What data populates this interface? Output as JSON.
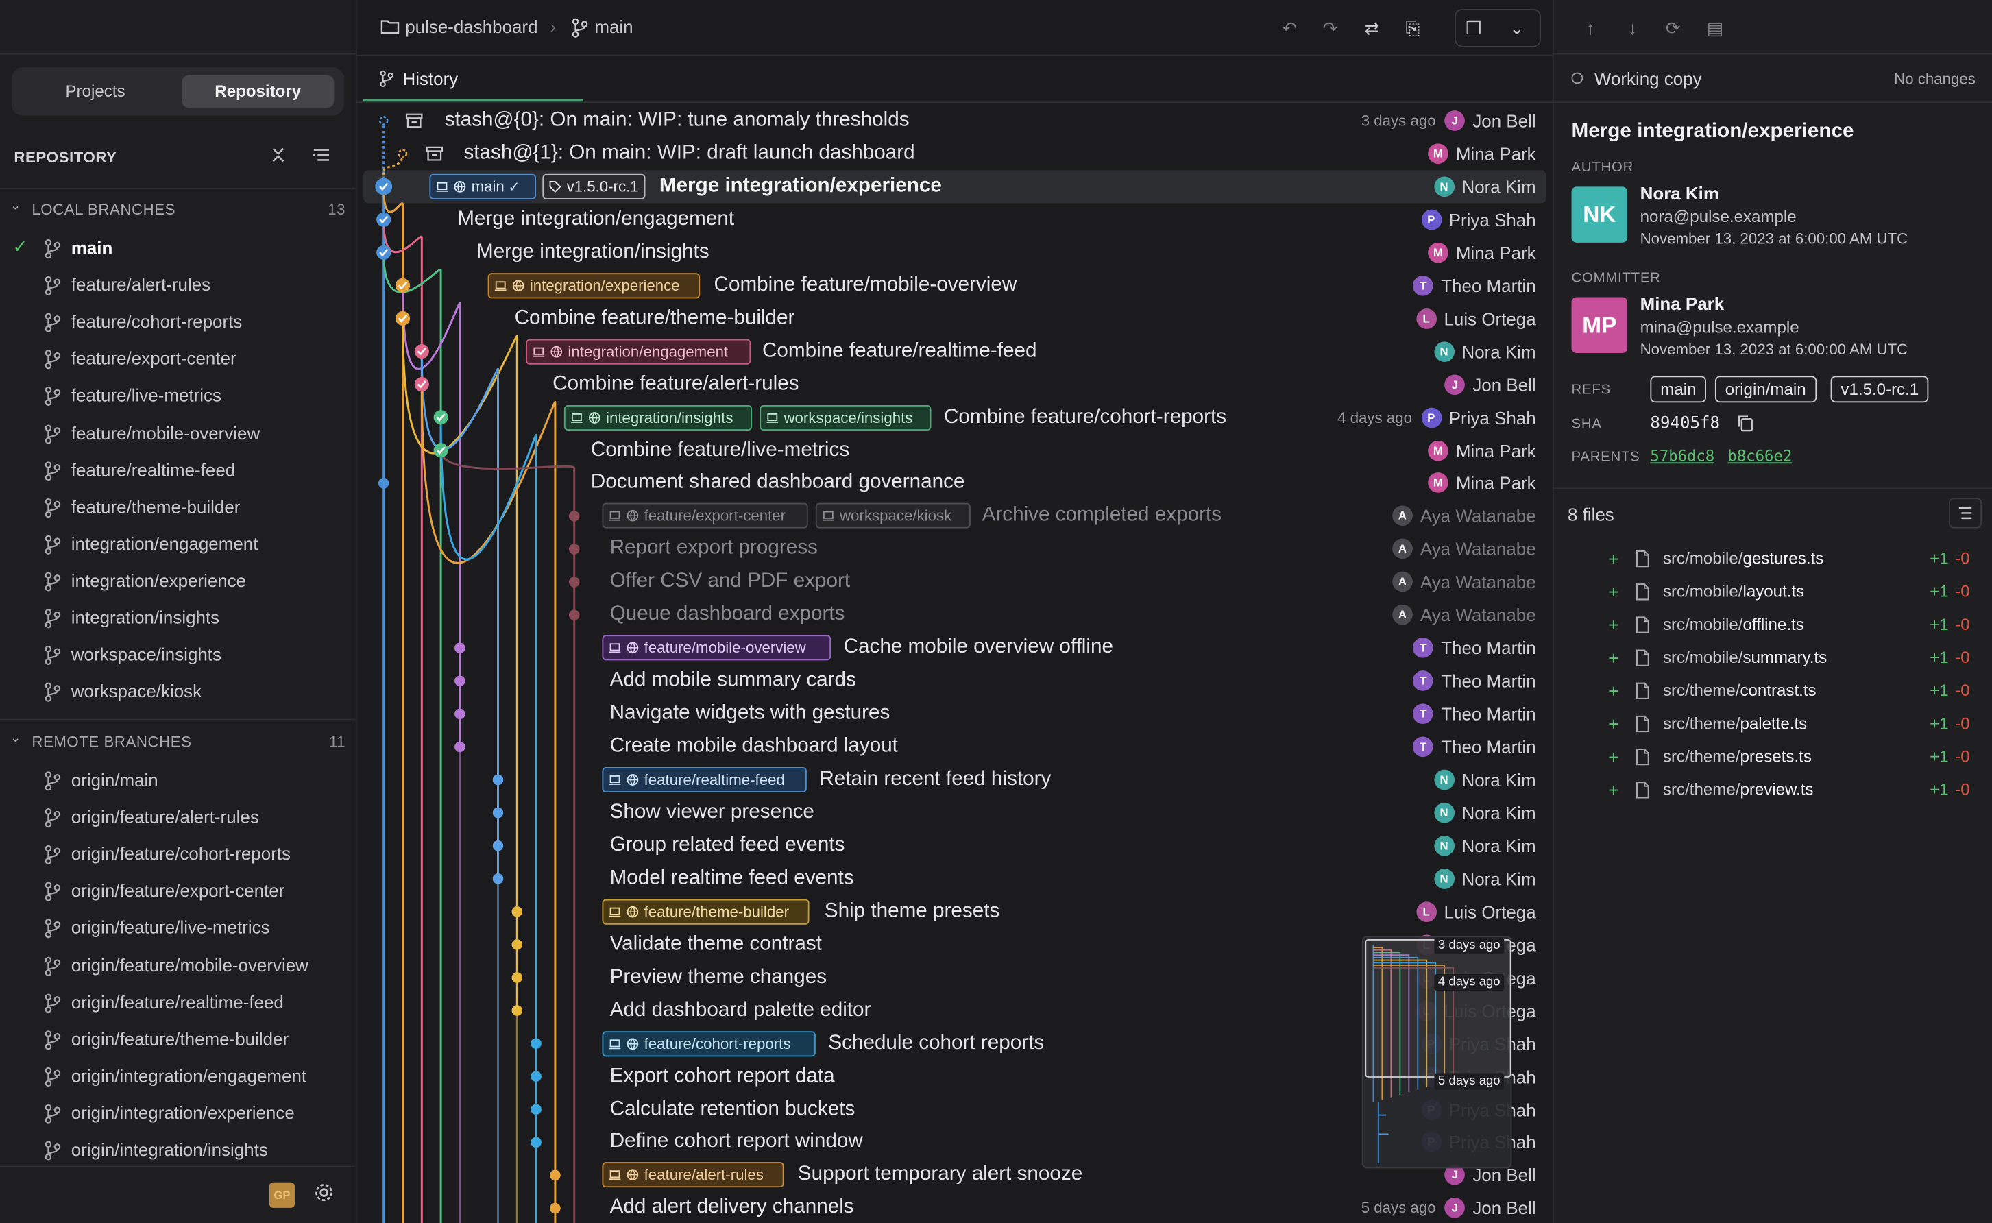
{
  "breadcrumb": {
    "repo": "pulse-dashboard",
    "branch": "main"
  },
  "sidebar": {
    "tabs": [
      "Projects",
      "Repository"
    ],
    "active_tab": "Repository",
    "section_title": "REPOSITORY",
    "local": {
      "title": "LOCAL BRANCHES",
      "count": "13",
      "current": "main",
      "items": [
        "main",
        "feature/alert-rules",
        "feature/cohort-reports",
        "feature/export-center",
        "feature/live-metrics",
        "feature/mobile-overview",
        "feature/realtime-feed",
        "feature/theme-builder",
        "integration/engagement",
        "integration/experience",
        "integration/insights",
        "workspace/insights",
        "workspace/kiosk"
      ]
    },
    "remote": {
      "title": "REMOTE BRANCHES",
      "count": "11",
      "items": [
        "origin/main",
        "origin/feature/alert-rules",
        "origin/feature/cohort-reports",
        "origin/feature/export-center",
        "origin/feature/live-metrics",
        "origin/feature/mobile-overview",
        "origin/feature/realtime-feed",
        "origin/feature/theme-builder",
        "origin/integration/engagement",
        "origin/integration/experience",
        "origin/integration/insights"
      ]
    },
    "footer_avatar": "GP"
  },
  "history": {
    "tab_label": "History",
    "commits": [
      {
        "message": "stash@{0}: On main: WIP: tune anomaly thresholds",
        "author": "Jon Bell",
        "initial": "J",
        "date": "3 days ago",
        "kind": "stash",
        "refs": []
      },
      {
        "message": "stash@{1}: On main: WIP: draft launch dashboard",
        "author": "Mina Park",
        "initial": "M",
        "kind": "stash",
        "refs": []
      },
      {
        "message": "Merge integration/experience",
        "author": "Nora Kim",
        "initial": "N",
        "selected": true,
        "refs": [
          {
            "label": "main",
            "style": "main"
          },
          {
            "label": "v1.5.0-rc.1",
            "style": "tag"
          }
        ]
      },
      {
        "message": "Merge integration/engagement",
        "author": "Priya Shah",
        "initial": "P",
        "refs": []
      },
      {
        "message": "Merge integration/insights",
        "author": "Mina Park",
        "initial": "M",
        "refs": []
      },
      {
        "message": "Combine feature/mobile-overview",
        "author": "Theo Martin",
        "initial": "T",
        "refs": [
          {
            "label": "integration/experience",
            "style": "orange"
          }
        ]
      },
      {
        "message": "Combine feature/theme-builder",
        "author": "Luis Ortega",
        "initial": "L",
        "refs": []
      },
      {
        "message": "Combine feature/realtime-feed",
        "author": "Nora Kim",
        "initial": "N",
        "refs": [
          {
            "label": "integration/engagement",
            "style": "pink"
          }
        ]
      },
      {
        "message": "Combine feature/alert-rules",
        "author": "Jon Bell",
        "initial": "J",
        "refs": []
      },
      {
        "message": "Combine feature/cohort-reports",
        "author": "Priya Shah",
        "initial": "P",
        "date": "4 days ago",
        "refs": [
          {
            "label": "integration/insights",
            "style": "green"
          },
          {
            "label": "workspace/insights",
            "style": "green",
            "noglobe": true
          }
        ]
      },
      {
        "message": "Combine feature/live-metrics",
        "author": "Mina Park",
        "initial": "M",
        "refs": []
      },
      {
        "message": "Document shared dashboard governance",
        "author": "Mina Park",
        "initial": "M",
        "refs": []
      },
      {
        "message": "Archive completed exports",
        "author": "Aya Watanabe",
        "initial": "A",
        "dim": true,
        "refs": [
          {
            "label": "feature/export-center",
            "style": "dim"
          },
          {
            "label": "workspace/kiosk",
            "style": "dim",
            "noglobe": true
          }
        ]
      },
      {
        "message": "Report export progress",
        "author": "Aya Watanabe",
        "initial": "A",
        "dim": true,
        "refs": []
      },
      {
        "message": "Offer CSV and PDF export",
        "author": "Aya Watanabe",
        "initial": "A",
        "dim": true,
        "refs": []
      },
      {
        "message": "Queue dashboard exports",
        "author": "Aya Watanabe",
        "initial": "A",
        "dim": true,
        "refs": []
      },
      {
        "message": "Cache mobile overview offline",
        "author": "Theo Martin",
        "initial": "T",
        "refs": [
          {
            "label": "feature/mobile-overview",
            "style": "purple"
          }
        ]
      },
      {
        "message": "Add mobile summary cards",
        "author": "Theo Martin",
        "initial": "T",
        "refs": []
      },
      {
        "message": "Navigate widgets with gestures",
        "author": "Theo Martin",
        "initial": "T",
        "refs": []
      },
      {
        "message": "Create mobile dashboard layout",
        "author": "Theo Martin",
        "initial": "T",
        "refs": []
      },
      {
        "message": "Retain recent feed history",
        "author": "Nora Kim",
        "initial": "N",
        "refs": [
          {
            "label": "feature/realtime-feed",
            "style": "blue"
          }
        ]
      },
      {
        "message": "Show viewer presence",
        "author": "Nora Kim",
        "initial": "N",
        "refs": []
      },
      {
        "message": "Group related feed events",
        "author": "Nora Kim",
        "initial": "N",
        "refs": []
      },
      {
        "message": "Model realtime feed events",
        "author": "Nora Kim",
        "initial": "N",
        "refs": []
      },
      {
        "message": "Ship theme presets",
        "author": "Luis Ortega",
        "initial": "L",
        "refs": [
          {
            "label": "feature/theme-builder",
            "style": "yellow"
          }
        ]
      },
      {
        "message": "Validate theme contrast",
        "author": "Luis Ortega",
        "initial": "L",
        "refs": []
      },
      {
        "message": "Preview theme changes",
        "author": "Luis Ortega",
        "initial": "L",
        "refs": []
      },
      {
        "message": "Add dashboard palette editor",
        "author": "Luis Ortega",
        "initial": "L",
        "refs": []
      },
      {
        "message": "Schedule cohort reports",
        "author": "Priya Shah",
        "initial": "P",
        "refs": [
          {
            "label": "feature/cohort-reports",
            "style": "sky"
          }
        ]
      },
      {
        "message": "Export cohort report data",
        "author": "Priya Shah",
        "initial": "P",
        "refs": []
      },
      {
        "message": "Calculate retention buckets",
        "author": "Priya Shah",
        "initial": "P",
        "refs": []
      },
      {
        "message": "Define cohort report window",
        "author": "Priya Shah",
        "initial": "P",
        "refs": []
      },
      {
        "message": "Support temporary alert snooze",
        "author": "Jon Bell",
        "initial": "J",
        "refs": [
          {
            "label": "feature/alert-rules",
            "style": "orange"
          }
        ]
      },
      {
        "message": "Add alert delivery channels",
        "author": "Jon Bell",
        "initial": "J",
        "date": "5 days ago",
        "refs": []
      }
    ],
    "minimap_labels": [
      "3 days ago",
      "4 days ago",
      "5 days ago"
    ]
  },
  "details": {
    "working_copy": "Working copy",
    "no_changes": "No changes",
    "title": "Merge integration/experience",
    "author_label": "AUTHOR",
    "author": {
      "initials": "NK",
      "name": "Nora Kim",
      "email": "nora@pulse.example",
      "date": "November 13, 2023 at 6:00:00 AM UTC"
    },
    "committer_label": "COMMITTER",
    "committer": {
      "initials": "MP",
      "name": "Mina Park",
      "email": "mina@pulse.example",
      "date": "November 13, 2023 at 6:00:00 AM UTC"
    },
    "refs_label": "REFS",
    "refs": [
      "main",
      "origin/main",
      "v1.5.0-rc.1"
    ],
    "sha_label": "SHA",
    "sha": "89405f8",
    "parents_label": "PARENTS",
    "parents": [
      "57b6dc8",
      "b8c66e2"
    ],
    "files_count": "8 files",
    "files": [
      {
        "dir": "src/mobile/",
        "name": "gestures.ts",
        "add": "+1",
        "del": "-0"
      },
      {
        "dir": "src/mobile/",
        "name": "layout.ts",
        "add": "+1",
        "del": "-0"
      },
      {
        "dir": "src/mobile/",
        "name": "offline.ts",
        "add": "+1",
        "del": "-0"
      },
      {
        "dir": "src/mobile/",
        "name": "summary.ts",
        "add": "+1",
        "del": "-0"
      },
      {
        "dir": "src/theme/",
        "name": "contrast.ts",
        "add": "+1",
        "del": "-0"
      },
      {
        "dir": "src/theme/",
        "name": "palette.ts",
        "add": "+1",
        "del": "-0"
      },
      {
        "dir": "src/theme/",
        "name": "presets.ts",
        "add": "+1",
        "del": "-0"
      },
      {
        "dir": "src/theme/",
        "name": "preview.ts",
        "add": "+1",
        "del": "-0"
      }
    ]
  },
  "colors": {
    "main_blue": "#4a90d9",
    "orange": "#e8a23b",
    "pink": "#e0688a",
    "green": "#52c187",
    "purple": "#b978d8",
    "blue": "#5aa0e6",
    "yellow": "#e8b83a",
    "sky": "#3aa8e0",
    "dim_red": "#8a4b55",
    "author_pink": "#c84f9a",
    "author_teal": "#3fb5b0"
  }
}
